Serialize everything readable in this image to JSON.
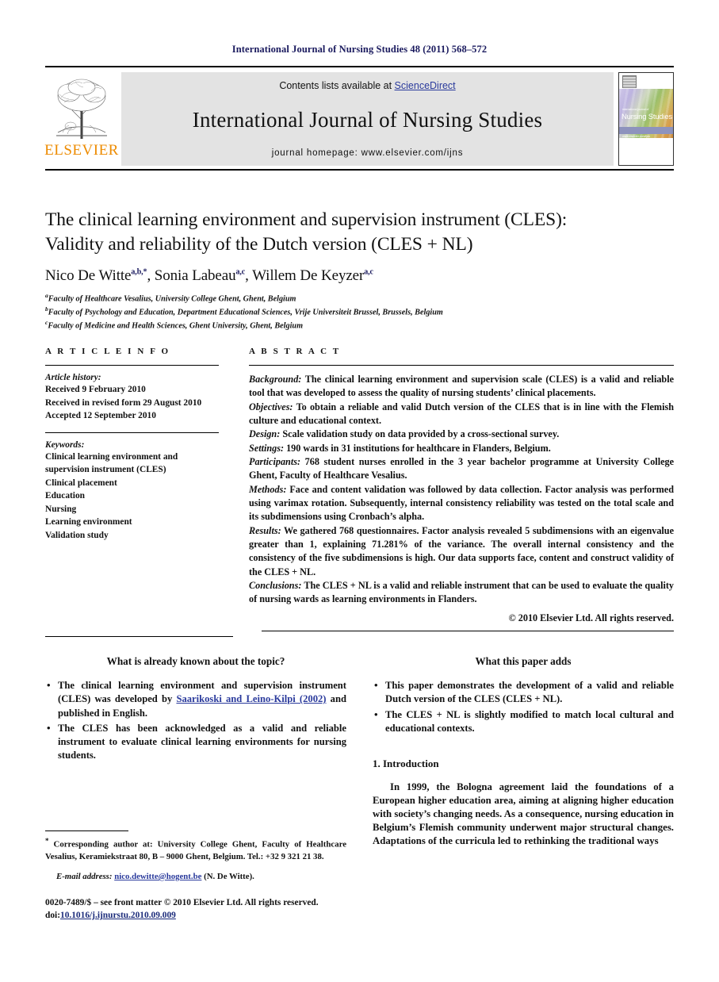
{
  "running_head": "International Journal of Nursing Studies 48 (2011) 568–572",
  "masthead": {
    "publisher_name": "ELSEVIER",
    "contents_prefix": "Contents lists available at ",
    "sciencedirect": "ScienceDirect",
    "journal_title": "International Journal of Nursing Studies",
    "homepage": "journal homepage: www.elsevier.com/ijns",
    "cover": {
      "tiny_top": "international journal of",
      "name": "Nursing Studies",
      "strip": "www.elsevier.com/ijns"
    }
  },
  "article": {
    "title_line1": "The clinical learning environment and supervision instrument (CLES):",
    "title_line2": "Validity and reliability of the Dutch version (CLES + NL)",
    "authors": [
      {
        "name": "Nico De Witte",
        "sup": "a,b,*"
      },
      {
        "name": "Sonia Labeau",
        "sup": "a,c"
      },
      {
        "name": "Willem De Keyzer",
        "sup": "a,c"
      }
    ],
    "affiliations": [
      {
        "marker": "a",
        "text": "Faculty of Healthcare Vesalius, University College Ghent, Ghent, Belgium"
      },
      {
        "marker": "b",
        "text": "Faculty of Psychology and Education, Department Educational Sciences, Vrije Universiteit Brussel, Brussels, Belgium"
      },
      {
        "marker": "c",
        "text": "Faculty of Medicine and Health Sciences, Ghent University, Ghent, Belgium"
      }
    ]
  },
  "article_info": {
    "section_label": "A R T I C L E   I N F O",
    "history_label": "Article history:",
    "history": [
      "Received 9 February 2010",
      "Received in revised form 29 August 2010",
      "Accepted 12 September 2010"
    ],
    "keywords_label": "Keywords:",
    "keywords": [
      "Clinical learning environment and",
      "supervision instrument (CLES)",
      "Clinical placement",
      "Education",
      "Nursing",
      "Learning environment",
      "Validation study"
    ]
  },
  "abstract": {
    "section_label": "A B S T R A C T",
    "background_label": "Background:",
    "background_text": " The clinical learning environment and supervision scale (CLES) is a valid and reliable tool that was developed to assess the quality of nursing students’ clinical placements.",
    "objectives_label": "Objectives:",
    "objectives_text": " To obtain a reliable and valid Dutch version of the CLES that is in line with the Flemish culture and educational context.",
    "design_label": "Design:",
    "design_text": " Scale validation study on data provided by a cross-sectional survey.",
    "settings_label": "Settings:",
    "settings_text": " 190 wards in 31 institutions for healthcare in Flanders, Belgium.",
    "participants_label": "Participants:",
    "participants_text": " 768 student nurses enrolled in the 3 year bachelor programme at University College Ghent, Faculty of Healthcare Vesalius.",
    "methods_label": "Methods:",
    "methods_text": " Face and content validation was followed by data collection. Factor analysis was performed using varimax rotation. Subsequently, internal consistency reliability was tested on the total scale and its subdimensions using Cronbach’s alpha.",
    "results_label": "Results:",
    "results_text": " We gathered 768 questionnaires. Factor analysis revealed 5 subdimensions with an eigenvalue greater than 1, explaining 71.281% of the variance. The overall internal consistency and the consistency of the five subdimensions is high. Our data supports face, content and construct validity of the CLES + NL.",
    "conclusions_label": "Conclusions:",
    "conclusions_text": " The CLES + NL is a valid and reliable instrument that can be used to evaluate the quality of nursing wards as learning environments in Flanders.",
    "copyright": "© 2010 Elsevier Ltd. All rights reserved."
  },
  "known_box": {
    "title": "What is already known about the topic?",
    "bullet1_pre": "The clinical learning environment and supervision instrument (CLES) was developed by ",
    "bullet1_cite": "Saarikoski and Leino-Kilpi (2002)",
    "bullet1_post": " and published in English.",
    "bullet2": "The CLES has been acknowledged as a valid and reliable instrument to evaluate clinical learning environments for nursing students."
  },
  "adds_box": {
    "title": "What this paper adds",
    "bullet1": "This paper demonstrates the development of a valid and reliable Dutch version of the CLES (CLES + NL).",
    "bullet2": "The CLES + NL is slightly modified to match local cultural and educational contexts."
  },
  "introduction": {
    "heading": "1. Introduction",
    "paragraph": "In 1999, the Bologna agreement laid the foundations of a European higher education area, aiming at aligning higher education with society’s changing needs. As a consequence, nursing education in Belgium’s Flemish community underwent major structural changes. Adaptations of the curricula led to rethinking the traditional ways"
  },
  "footnotes": {
    "corresponding_marker": "*",
    "corresponding_text": " Corresponding author at: University College Ghent, Faculty of Healthcare Vesalius, Keramiekstraat 80, B – 9000 Ghent, Belgium. Tel.: +32 9 321 21 38.",
    "email_label": "E-mail address:",
    "email_address": "nico.dewitte@hogent.be",
    "email_suffix": " (N. De Witte).",
    "front_matter": "0020-7489/$ – see front matter © 2010 Elsevier Ltd. All rights reserved.",
    "doi_prefix": "doi:",
    "doi": "10.1016/j.ijnurstu.2010.09.009"
  },
  "colors": {
    "running_head": "#1a1a5e",
    "elsevier_orange": "#ED8B00",
    "link_blue": "#2a3a9c",
    "banner_grey": "#e3e3e3"
  }
}
